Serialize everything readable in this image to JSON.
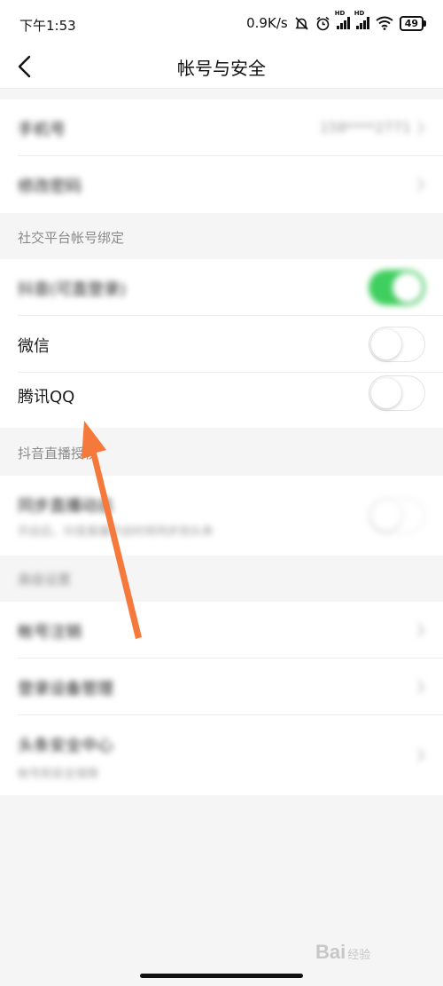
{
  "status_bar": {
    "time": "下午1:53",
    "speed": "0.9K/s",
    "battery": "49",
    "icons": [
      "muted-bell-icon",
      "alarm-icon",
      "signal-hd-icon",
      "signal-hd-icon",
      "wifi-icon",
      "battery-icon"
    ]
  },
  "header": {
    "title": "帐号与安全",
    "back_icon": "chevron-left-icon"
  },
  "account_group": {
    "phone_label": "手机号",
    "phone_value": "158****2771",
    "password_label": "修改密码"
  },
  "social_section": {
    "header": "社交平台帐号绑定",
    "rows": [
      {
        "label": "抖音(可直登录)",
        "toggle": "on"
      },
      {
        "label": "微信",
        "toggle": "off"
      },
      {
        "label": "腾讯QQ",
        "toggle": "off"
      }
    ]
  },
  "live_section": {
    "header": "抖音直播授权",
    "sync_label": "同步直播动态",
    "sync_desc": "开启后，抖音直播开启时将同步到头条",
    "sync_toggle": "off"
  },
  "advanced_section": {
    "header": "高级设置",
    "rows": [
      {
        "label": "帐号注销"
      },
      {
        "label": "登录设备管理"
      },
      {
        "label": "头条安全中心",
        "desc": "帐号和安全保障"
      }
    ]
  },
  "watermark": {
    "brand": "Bai",
    "brand_suffix": "经验"
  },
  "colors": {
    "toggle_on": "#3fcf5e",
    "arrow": "#f4793a",
    "background": "#f5f5f5"
  }
}
